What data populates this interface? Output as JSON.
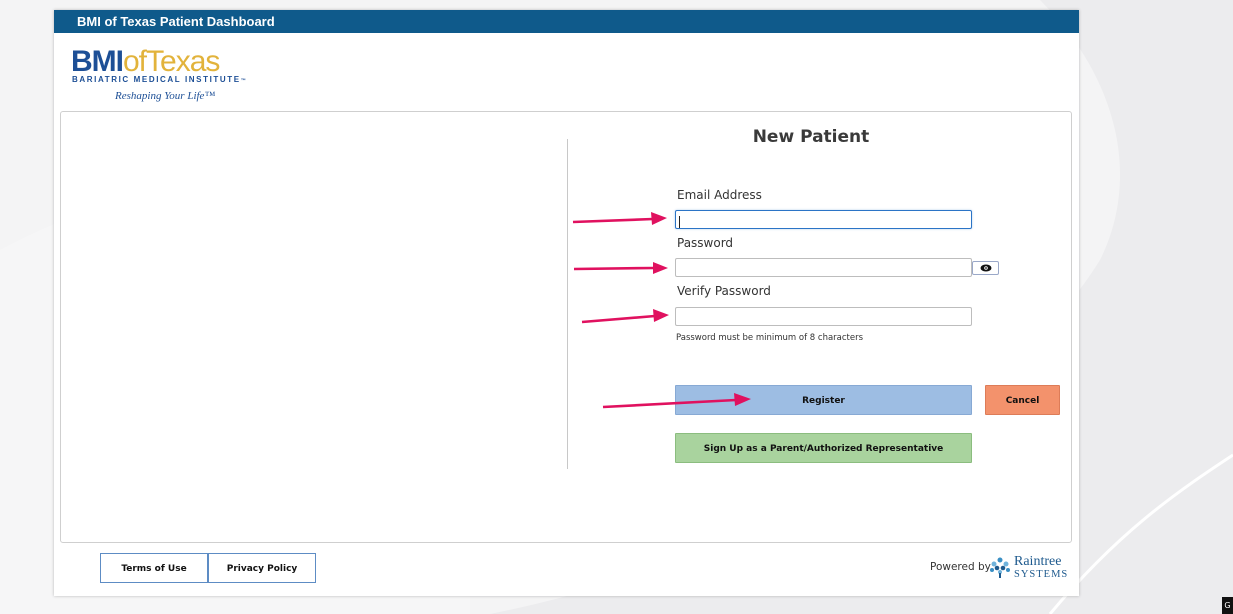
{
  "window": {
    "title": "BMI of Texas Patient Dashboard"
  },
  "logo": {
    "main_bmi": "BMI",
    "main_of": "of",
    "main_texas": "Texas",
    "subtitle": "BARIATRIC MEDICAL INSTITUTE",
    "trademark": "™",
    "tagline": "Reshaping Your Life™"
  },
  "form": {
    "heading": "New Patient",
    "email_label": "Email Address",
    "email_value": "",
    "password_label": "Password",
    "password_value": "",
    "verify_label": "Verify Password",
    "verify_value": "",
    "hint": "Password must be minimum of 8 characters",
    "register_label": "Register",
    "cancel_label": "Cancel",
    "signup_label": "Sign Up as a Parent/Authorized Representative"
  },
  "footer": {
    "terms_label": "Terms of Use",
    "privacy_label": "Privacy Policy",
    "powered_by": "Powered by",
    "vendor_name": "Raintree",
    "vendor_sub": "SYSTEMS"
  },
  "corner_badge": "G",
  "icons": {
    "show_password": "eye-icon",
    "vendor": "raintree-logo-icon"
  },
  "colors": {
    "titlebar": "#0f5a8b",
    "register": "#9dbde3",
    "cancel": "#f3926c",
    "signup": "#a9d39e",
    "annotation_arrow": "#e0115f"
  }
}
